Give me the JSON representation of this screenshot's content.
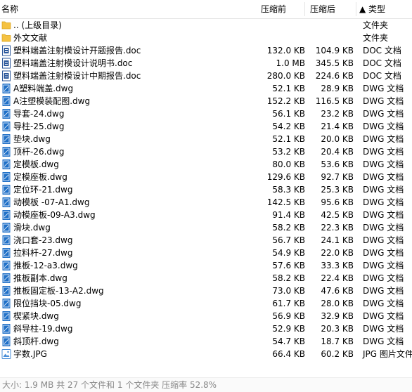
{
  "header": {
    "col_name": "名称",
    "col_original": "压缩前",
    "col_compressed": "压缩后",
    "col_type": "▲ 类型"
  },
  "colors": {
    "folder": "#f5c242",
    "doc_icon": "#2b579a",
    "dwg_icon": "#1e6fc7",
    "jpg_icon": "#4a8fd8",
    "status_text": "#888888"
  },
  "files": [
    {
      "name": ".. (上级目录)",
      "original": "",
      "compressed": "",
      "type": "文件夹",
      "icon": "folder-icon"
    },
    {
      "name": "外文文献",
      "original": "",
      "compressed": "",
      "type": "文件夹",
      "icon": "folder-icon"
    },
    {
      "name": "塑料端盖注射模设计开题报告.doc",
      "original": "132.0 KB",
      "compressed": "104.9 KB",
      "type": "DOC 文档",
      "icon": "doc-file-icon"
    },
    {
      "name": "塑料端盖注射模设计说明书.doc",
      "original": "1.0 MB",
      "compressed": "345.5 KB",
      "type": "DOC 文档",
      "icon": "doc-file-icon"
    },
    {
      "name": "塑料端盖注射模设计中期报告.doc",
      "original": "280.0 KB",
      "compressed": "224.6 KB",
      "type": "DOC 文档",
      "icon": "doc-file-icon"
    },
    {
      "name": "A塑料端盖.dwg",
      "original": "52.1 KB",
      "compressed": "28.9 KB",
      "type": "DWG 文档",
      "icon": "dwg-file-icon"
    },
    {
      "name": "A注塑模装配图.dwg",
      "original": "152.2 KB",
      "compressed": "116.5 KB",
      "type": "DWG 文档",
      "icon": "dwg-file-icon"
    },
    {
      "name": "导套-24.dwg",
      "original": "56.1 KB",
      "compressed": "23.2 KB",
      "type": "DWG 文档",
      "icon": "dwg-file-icon"
    },
    {
      "name": "导柱-25.dwg",
      "original": "54.2 KB",
      "compressed": "21.4 KB",
      "type": "DWG 文档",
      "icon": "dwg-file-icon"
    },
    {
      "name": "垫块.dwg",
      "original": "52.1 KB",
      "compressed": "20.0 KB",
      "type": "DWG 文档",
      "icon": "dwg-file-icon"
    },
    {
      "name": "顶杆-26.dwg",
      "original": "53.2 KB",
      "compressed": "20.4 KB",
      "type": "DWG 文档",
      "icon": "dwg-file-icon"
    },
    {
      "name": "定模板.dwg",
      "original": "80.0 KB",
      "compressed": "53.6 KB",
      "type": "DWG 文档",
      "icon": "dwg-file-icon"
    },
    {
      "name": "定模座板.dwg",
      "original": "129.6 KB",
      "compressed": "92.7 KB",
      "type": "DWG 文档",
      "icon": "dwg-file-icon"
    },
    {
      "name": "定位环-21.dwg",
      "original": "58.3 KB",
      "compressed": "25.3 KB",
      "type": "DWG 文档",
      "icon": "dwg-file-icon"
    },
    {
      "name": "动模板 -07-A1.dwg",
      "original": "142.5 KB",
      "compressed": "95.6 KB",
      "type": "DWG 文档",
      "icon": "dwg-file-icon"
    },
    {
      "name": "动模座板-09-A3.dwg",
      "original": "91.4 KB",
      "compressed": "42.5 KB",
      "type": "DWG 文档",
      "icon": "dwg-file-icon"
    },
    {
      "name": "滑块.dwg",
      "original": "58.2 KB",
      "compressed": "22.3 KB",
      "type": "DWG 文档",
      "icon": "dwg-file-icon"
    },
    {
      "name": "浇口套-23.dwg",
      "original": "56.7 KB",
      "compressed": "24.1 KB",
      "type": "DWG 文档",
      "icon": "dwg-file-icon"
    },
    {
      "name": "拉料杆-27.dwg",
      "original": "54.9 KB",
      "compressed": "22.0 KB",
      "type": "DWG 文档",
      "icon": "dwg-file-icon"
    },
    {
      "name": "推板-12-a3.dwg",
      "original": "57.6 KB",
      "compressed": "33.3 KB",
      "type": "DWG 文档",
      "icon": "dwg-file-icon"
    },
    {
      "name": "推板副本.dwg",
      "original": "58.2 KB",
      "compressed": "22.4 KB",
      "type": "DWG 文档",
      "icon": "dwg-file-icon"
    },
    {
      "name": "推板固定板-13-A2.dwg",
      "original": "73.0 KB",
      "compressed": "47.6 KB",
      "type": "DWG 文档",
      "icon": "dwg-file-icon"
    },
    {
      "name": "限位挡块-05.dwg",
      "original": "61.7 KB",
      "compressed": "28.0 KB",
      "type": "DWG 文档",
      "icon": "dwg-file-icon"
    },
    {
      "name": "楔紧块.dwg",
      "original": "56.9 KB",
      "compressed": "32.9 KB",
      "type": "DWG 文档",
      "icon": "dwg-file-icon"
    },
    {
      "name": "斜导柱-19.dwg",
      "original": "52.9 KB",
      "compressed": "20.3 KB",
      "type": "DWG 文档",
      "icon": "dwg-file-icon"
    },
    {
      "name": "斜顶杆.dwg",
      "original": "54.7 KB",
      "compressed": "18.7 KB",
      "type": "DWG 文档",
      "icon": "dwg-file-icon"
    },
    {
      "name": "字数.JPG",
      "original": "66.4 KB",
      "compressed": "60.2 KB",
      "type": "JPG 图片文件",
      "icon": "jpg-file-icon"
    }
  ],
  "status_bar": {
    "text": "大小: 1.9 MB 共 27 个文件和 1 个文件夹 压缩率 52.8%"
  }
}
